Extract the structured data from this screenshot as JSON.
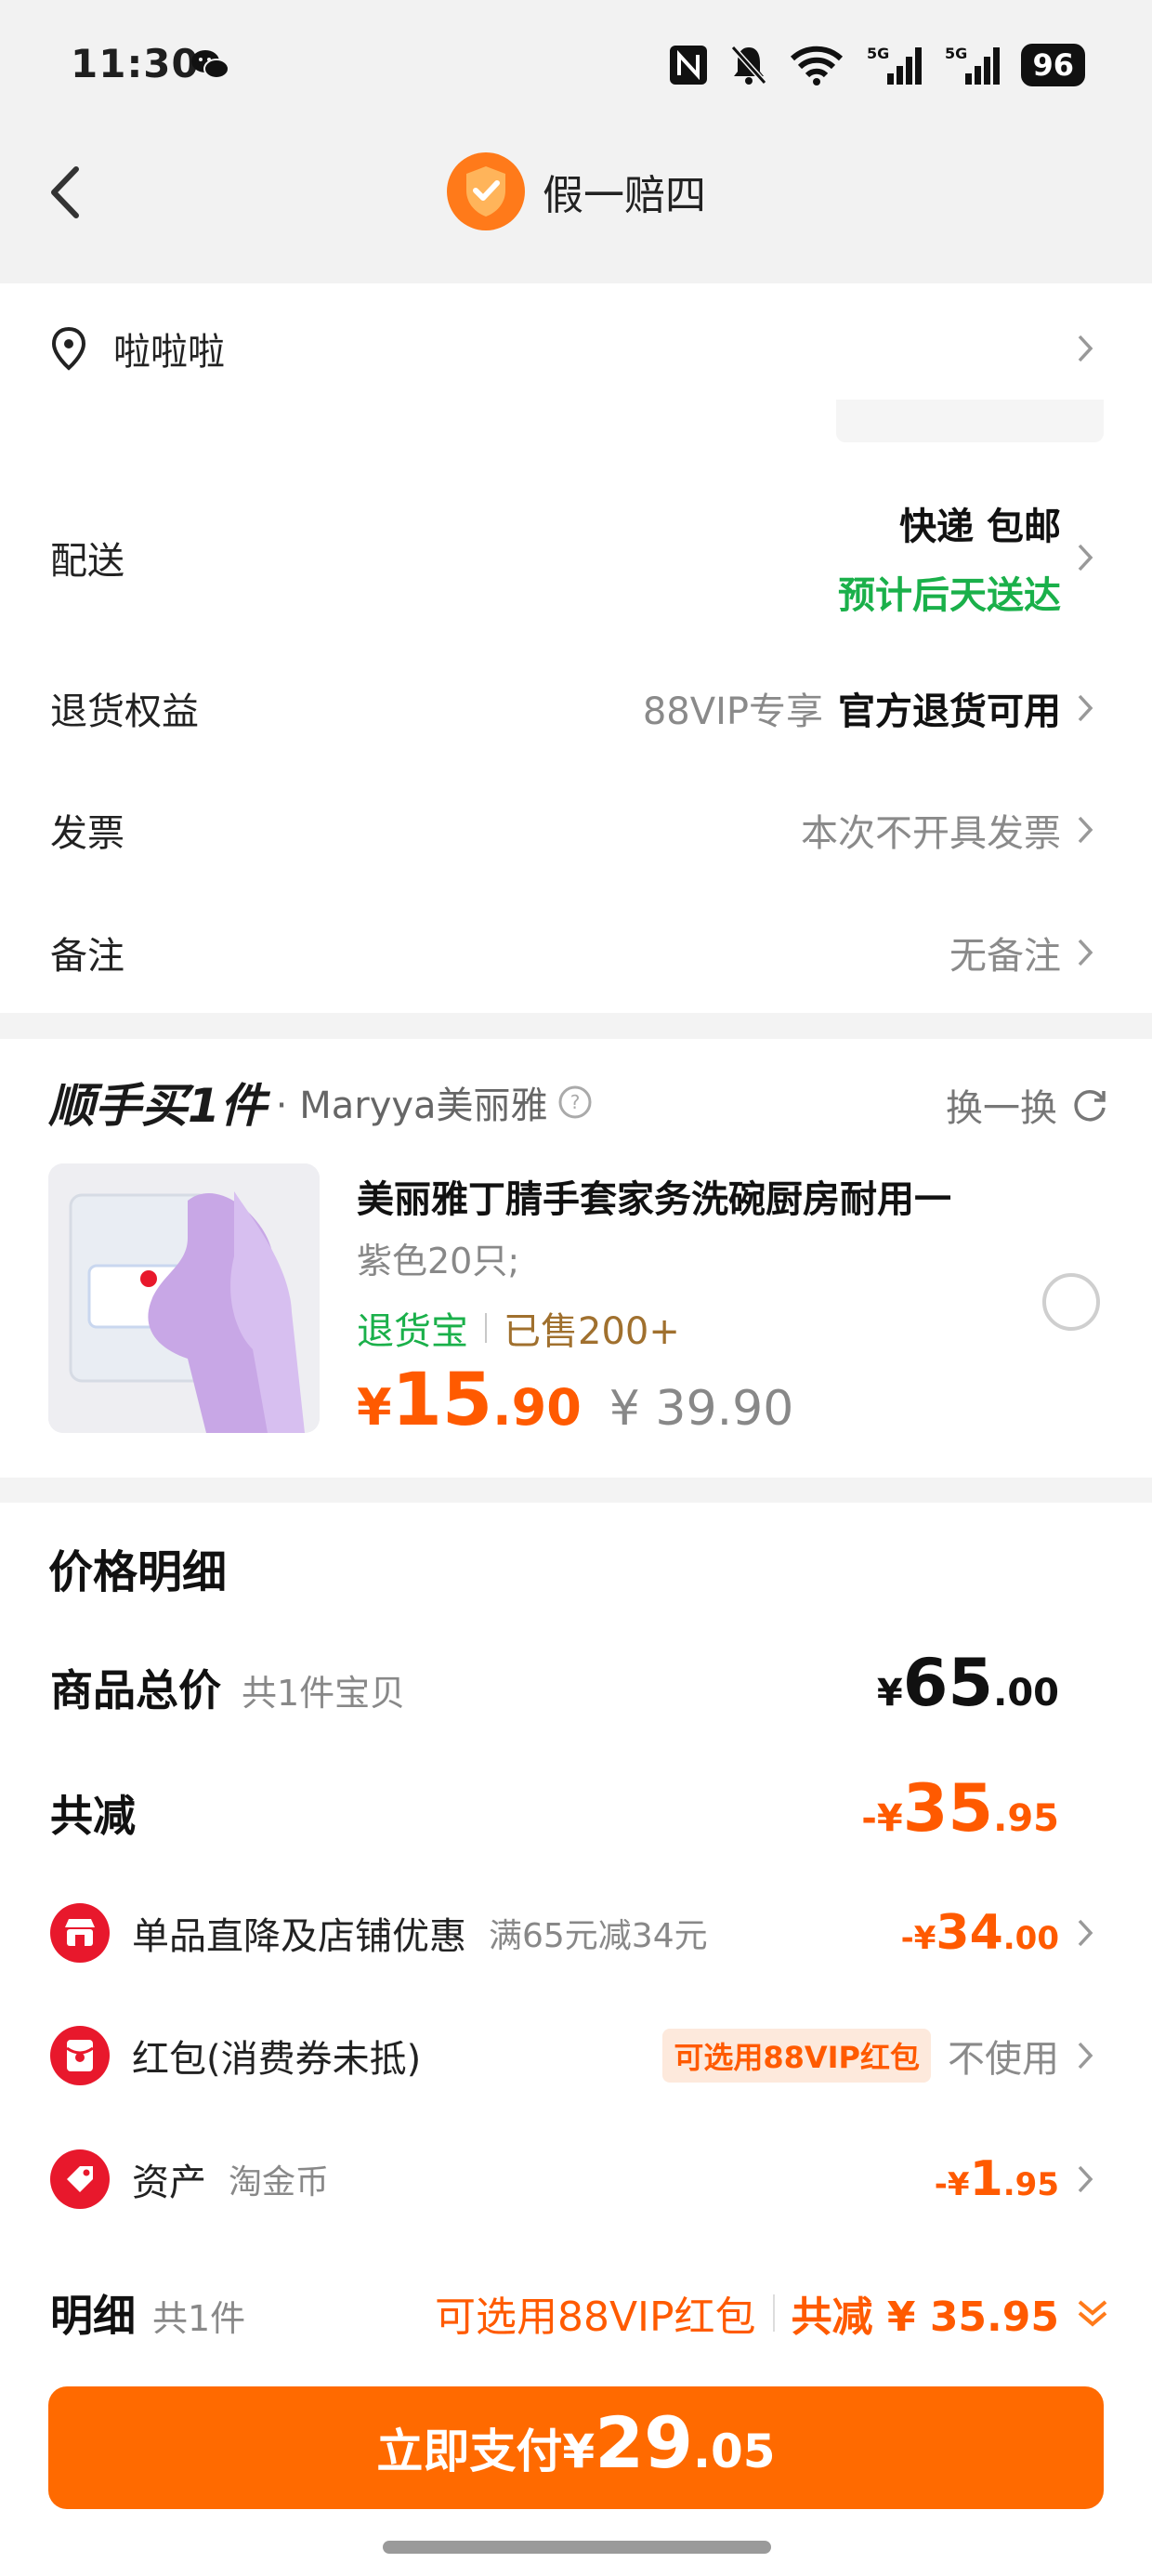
{
  "status_bar": {
    "time": "11:30",
    "battery": "96",
    "icons": [
      "wechat-icon",
      "nfc-icon",
      "mute-bell-icon",
      "wifi-icon",
      "5g-signal-icon",
      "5g-signal-icon"
    ]
  },
  "header": {
    "title": "假一赔四",
    "icons": [
      "back-arrow-icon",
      "shield-check-icon"
    ]
  },
  "address": {
    "text": "啦啦啦"
  },
  "delivery": {
    "label": "配送",
    "method": "快递 包邮",
    "eta": "预计后天送达"
  },
  "returns": {
    "label": "退货权益",
    "vip": "88VIP专享",
    "value": "官方退货可用"
  },
  "invoice": {
    "label": "发票",
    "value": "本次不开具发票"
  },
  "remark": {
    "label": "备注",
    "value": "无备注"
  },
  "bundle": {
    "title": "顺手买1件",
    "brand": "· Maryya美丽雅",
    "swap_label": "换一换",
    "product": {
      "name": "美丽雅丁腈手套家务洗碗厨房耐用一",
      "spec": "紫色20只;",
      "tag_return": "退货宝",
      "tag_sold": "已售200+",
      "price_currency": "¥",
      "price_int": "15",
      "price_dec": ".90",
      "price_old": "¥ 39.90"
    }
  },
  "price_detail": {
    "title": "价格明细",
    "total": {
      "label": "商品总价",
      "sub": "共1件宝贝",
      "currency": "¥",
      "int": "65",
      "dec": ".00"
    },
    "reduction": {
      "label": "共减",
      "currency": "-¥",
      "int": "35",
      "dec": ".95"
    },
    "items": [
      {
        "icon": "shop-icon",
        "label": "单品直降及店铺优惠",
        "sub": "满65元减34元",
        "currency": "-¥",
        "int": "34",
        "dec": ".00"
      },
      {
        "icon": "red-packet-icon",
        "label": "红包(消费券未抵)",
        "chip": "可选用88VIP红包",
        "value": "不使用"
      },
      {
        "icon": "coin-tag-icon",
        "label": "资产",
        "sub": "淘金币",
        "currency": "-¥",
        "int": "1",
        "dec": ".95"
      }
    ]
  },
  "detail_bar": {
    "title": "明细",
    "count": "共1件",
    "vip_hint": "可选用88VIP红包",
    "total_reduce": "共减 ¥ 35.95"
  },
  "pay_button": {
    "label": "立即支付",
    "currency": "¥",
    "int": "29",
    "dec": ".05"
  },
  "colors": {
    "accent": "#ff6a00",
    "green": "#1ab04a",
    "red": "#e8182c"
  }
}
